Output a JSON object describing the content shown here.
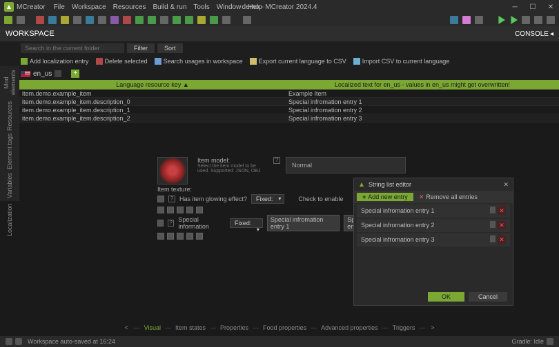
{
  "titlebar": {
    "app_name": "MCreator",
    "menus": [
      "File",
      "Workspace",
      "Resources",
      "Build & run",
      "Tools",
      "Window",
      "Help"
    ],
    "title": "demo - MCreator 2024.4"
  },
  "workspace": {
    "label": "WORKSPACE",
    "console": "CONSOLE"
  },
  "search": {
    "placeholder": "Search in the current folder",
    "filter": "Filter",
    "sort": "Sort"
  },
  "actions": {
    "add": "Add localization entry",
    "delete": "Delete selected",
    "search": "Search usages in workspace",
    "export": "Export current language to CSV",
    "import": "Import CSV to current language"
  },
  "lang": {
    "code": "en_us"
  },
  "table": {
    "header_key": "Language resource key ▲",
    "header_val": "Localized text for en_us - values in en_us might get overwritten!",
    "rows": [
      {
        "key": "item.demo.example_item",
        "val": "Example Item"
      },
      {
        "key": "item.demo.example_item.description_0",
        "val": "Special infromation entry 1"
      },
      {
        "key": "item.demo.example_item.description_1",
        "val": "Special infromation entry 2"
      },
      {
        "key": "item.demo.example_item.description_2",
        "val": "Special infromation entry 3"
      }
    ]
  },
  "sidebar": [
    "Mod elements",
    "Resources",
    "Element tags",
    "Variables",
    "Localization"
  ],
  "editor": {
    "item_texture": "Item texture:",
    "item_model": "Item model:",
    "item_model_sub": "Select the item model to be used. Supported: JSON, OBJ",
    "model_value": "Normal",
    "glow_label": "Has item glowing effect?",
    "glow_fixed": "Fixed:",
    "glow_check": "Check to enable",
    "special_label": "Special information",
    "special_fixed": "Fixed:",
    "chips": [
      "Special infromation entry 1",
      "Special infromation en"
    ]
  },
  "dialog": {
    "title": "String list editor",
    "add": "Add new entry",
    "remove": "Remove all entries",
    "items": [
      "Special infromation entry 1",
      "Special infromation entry 2",
      "Special infromation entry 3"
    ],
    "ok": "OK",
    "cancel": "Cancel"
  },
  "bottom_tabs": [
    "Visual",
    "Item states",
    "Properties",
    "Food properties",
    "Advanced properties",
    "Triggers"
  ],
  "status": {
    "left": "Workspace auto-saved at 16:24",
    "right": "Gradle: Idle"
  }
}
